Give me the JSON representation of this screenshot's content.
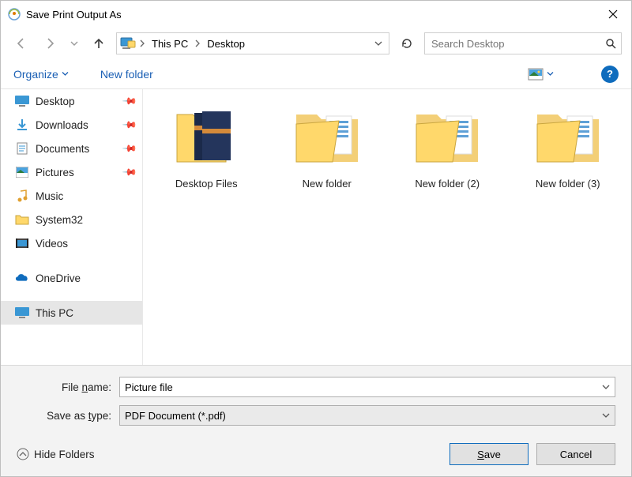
{
  "title": "Save Print Output As",
  "breadcrumbs": {
    "root": "This PC",
    "current": "Desktop"
  },
  "search": {
    "placeholder": "Search Desktop"
  },
  "toolbar": {
    "organize": "Organize",
    "newfolder": "New folder"
  },
  "sidebar": {
    "quick": [
      {
        "label": "Desktop",
        "pinned": true
      },
      {
        "label": "Downloads",
        "pinned": true
      },
      {
        "label": "Documents",
        "pinned": true
      },
      {
        "label": "Pictures",
        "pinned": true
      },
      {
        "label": "Music",
        "pinned": false
      },
      {
        "label": "System32",
        "pinned": false
      },
      {
        "label": "Videos",
        "pinned": false
      }
    ],
    "onedrive": "OneDrive",
    "thispc": "This PC"
  },
  "items": [
    {
      "label": "Desktop Files",
      "kind": "stack-dark"
    },
    {
      "label": "New folder",
      "kind": "folder-docs"
    },
    {
      "label": "New folder (2)",
      "kind": "folder-docs"
    },
    {
      "label": "New folder (3)",
      "kind": "folder-docs"
    }
  ],
  "fields": {
    "filename_label": "File name:",
    "filename_value": "Picture file",
    "savetype_label": "Save as type:",
    "savetype_value": "PDF Document (*.pdf)"
  },
  "actions": {
    "hide_folders": "Hide Folders",
    "save": "Save",
    "cancel": "Cancel"
  }
}
